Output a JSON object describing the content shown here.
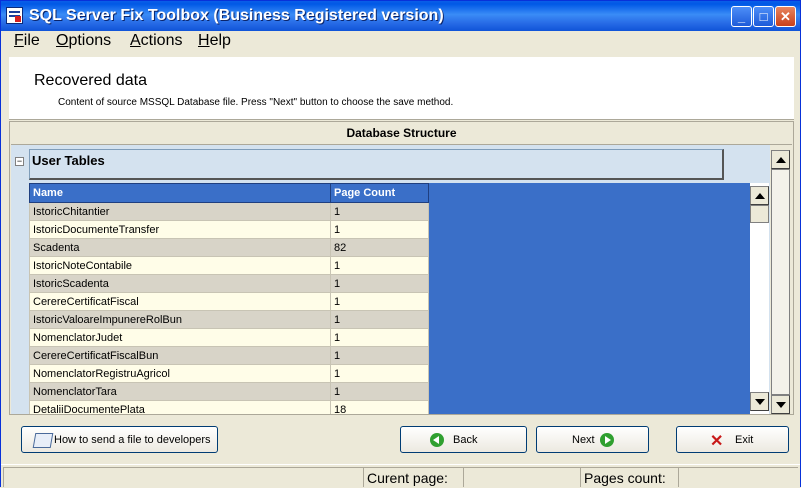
{
  "window": {
    "title": "SQL Server Fix Toolbox (Business Registered version)"
  },
  "menu": [
    {
      "label": "File",
      "ul": "F",
      "rest": "ile"
    },
    {
      "label": "Options",
      "ul": "O",
      "rest": "ptions"
    },
    {
      "label": "Actions",
      "ul": "A",
      "rest": "ctions"
    },
    {
      "label": "Help",
      "ul": "H",
      "rest": "elp"
    }
  ],
  "header": {
    "title": "Recovered data",
    "subtitle": "Content of source MSSQL Database file. Press \"Next\" button to choose the save method."
  },
  "structure": {
    "title": "Database Structure",
    "section": "User Tables",
    "collapse_symbol": "−"
  },
  "table": {
    "columns": [
      "Name",
      "Page Count"
    ],
    "rows": [
      [
        "IstoricChitantier",
        "1"
      ],
      [
        "IstoricDocumenteTransfer",
        "1"
      ],
      [
        "Scadenta",
        "82"
      ],
      [
        "IstoricNoteContabile",
        "1"
      ],
      [
        "IstoricScadenta",
        "1"
      ],
      [
        "CerereCertificatFiscal",
        "1"
      ],
      [
        "IstoricValoareImpunereRolBun",
        "1"
      ],
      [
        "NomenclatorJudet",
        "1"
      ],
      [
        "CerereCertificatFiscalBun",
        "1"
      ],
      [
        "NomenclatorRegistruAgricol",
        "1"
      ],
      [
        "NomenclatorTara",
        "1"
      ],
      [
        "DetaliiDocumentePlata",
        "18"
      ]
    ]
  },
  "buttons": {
    "send": "How to send a file to developers",
    "back": "Back",
    "next": "Next",
    "exit": "Exit"
  },
  "status": {
    "current_page": "Curent page:",
    "pages_count": "Pages count:"
  },
  "colors": {
    "accent": "#3a6fc8",
    "title_bar": "#0058e6",
    "exit_icon": "#c81818",
    "nav_icon": "#30a030"
  }
}
